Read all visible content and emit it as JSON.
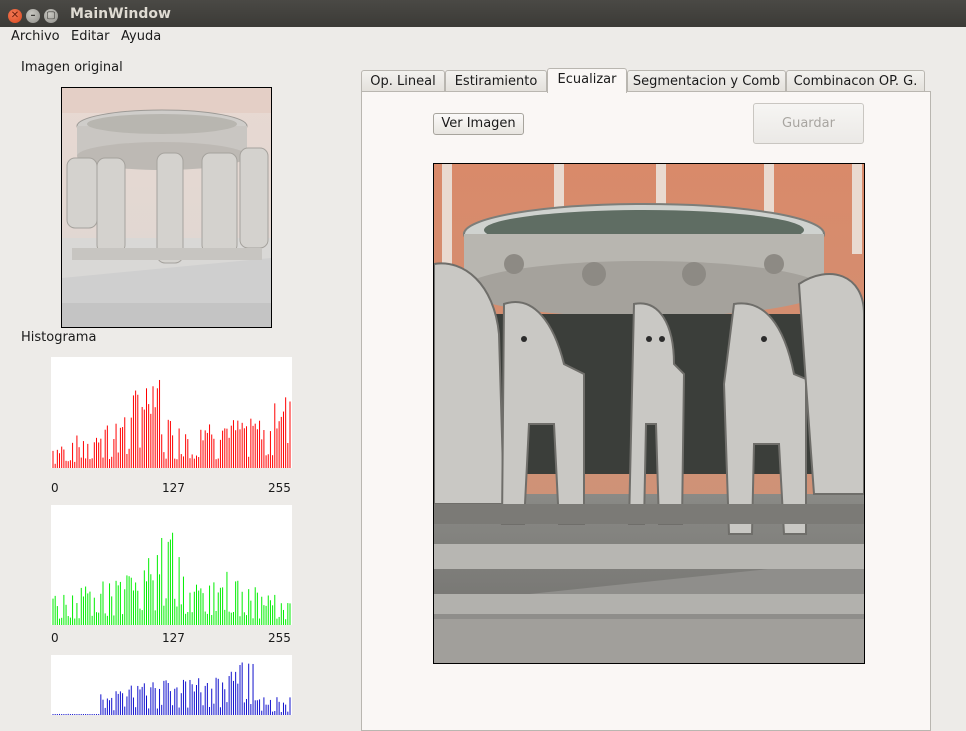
{
  "window": {
    "title": "MainWindow"
  },
  "menu": {
    "items": [
      "Archivo",
      "Editar",
      "Ayuda"
    ]
  },
  "left": {
    "original_label": "Imagen original",
    "histogram_label": "Histograma",
    "axis_ticks": [
      "0",
      "127",
      "255"
    ],
    "histograms": [
      {
        "channel": "red",
        "color": "#ff0000"
      },
      {
        "channel": "green",
        "color": "#00ee00"
      },
      {
        "channel": "blue",
        "color": "#1010cc"
      }
    ]
  },
  "tabs": {
    "items": [
      "Op. Lineal",
      "Estiramiento",
      "Ecualizar",
      "Segmentacion y Comb",
      "Combinacon OP. G."
    ],
    "active_index": 2
  },
  "panel": {
    "ver_imagen_label": "Ver Imagen",
    "guardar_label": "Guardar"
  }
}
